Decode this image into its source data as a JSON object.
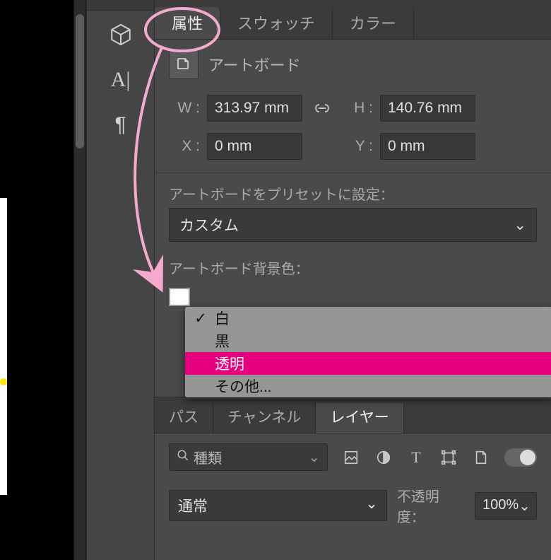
{
  "tabs_top": {
    "attributes": "属性",
    "swatches": "スウォッチ",
    "color": "カラー"
  },
  "artboard": {
    "label": "アートボード",
    "w_label": "W :",
    "w_value": "313.97 mm",
    "h_label": "H :",
    "h_value": "140.76 mm",
    "x_label": "X :",
    "x_value": "0 mm",
    "y_label": "Y :",
    "y_value": "0 mm"
  },
  "preset": {
    "label": "アートボードをプリセットに設定：",
    "value": "カスタム"
  },
  "bgcolor": {
    "label": "アートボード背景色：",
    "swatch_hex": "#ffffff",
    "options": {
      "white": "白",
      "black": "黒",
      "transparent": "透明",
      "other": "その他..."
    },
    "checked": "white",
    "highlighted": "transparent"
  },
  "tabs_bottom": {
    "paths": "パス",
    "channels": "チャンネル",
    "layers": "レイヤー"
  },
  "layers_panel": {
    "filter_label": "種類",
    "blend_mode": "通常",
    "opacity_label": "不透明度：",
    "opacity_value": "100%"
  },
  "left_tools": {
    "tool1": "A|",
    "tool2": "¶"
  }
}
